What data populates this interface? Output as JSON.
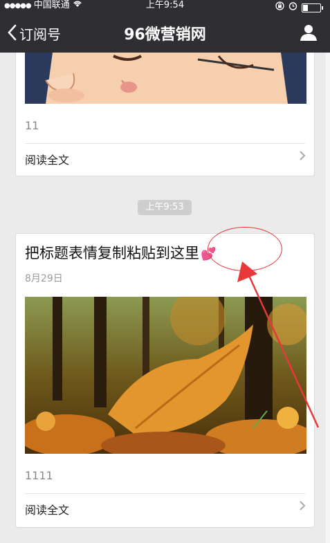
{
  "status_bar": {
    "signal_dots": "●●●●●",
    "carrier": "中国联通",
    "time": "上午9:54"
  },
  "nav": {
    "back_label": "订阅号",
    "title": "96微营销网"
  },
  "articles": [
    {
      "digest": "11",
      "read_all": "阅读全文"
    },
    {
      "title": "把标题表情复制粘贴到这里",
      "title_emoji": "💕",
      "date": "8月29日",
      "digest": "1111",
      "read_all": "阅读全文"
    }
  ],
  "timestamp": "上午9:53",
  "icons": [
    "wifi-icon",
    "lock-rotation-icon",
    "alarm-icon",
    "battery-icon",
    "back-chevron-icon",
    "user-icon",
    "chevron-right-icon"
  ],
  "colors": {
    "navbar": "#2f2f33",
    "background": "#ebebeb",
    "annotation": "#e8383a"
  }
}
